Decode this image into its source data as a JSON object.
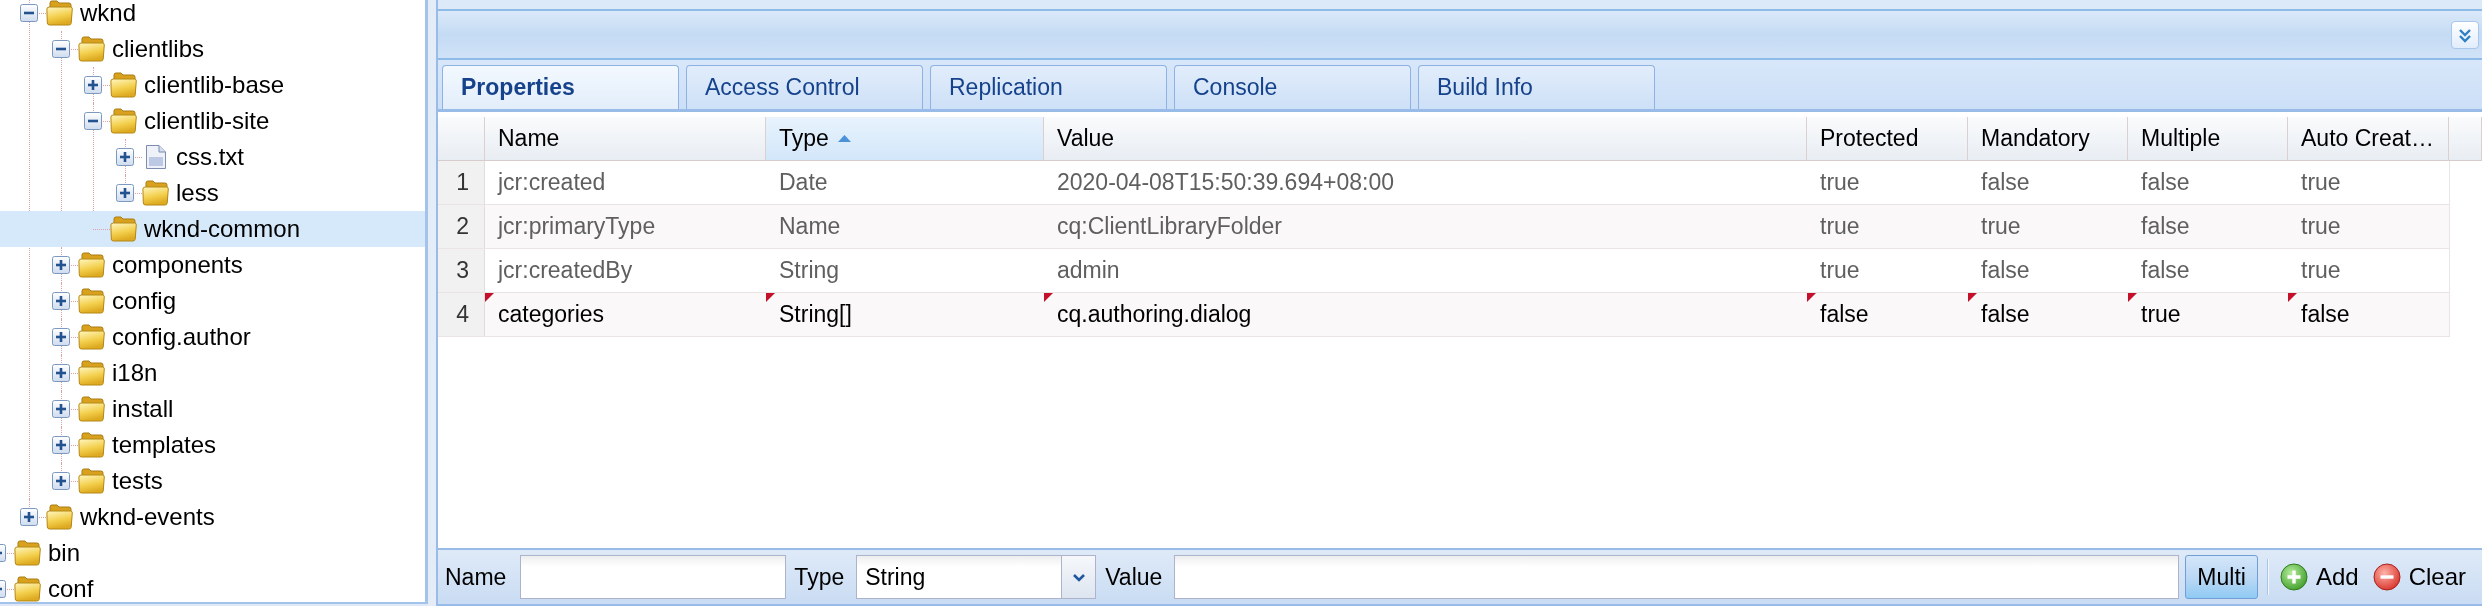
{
  "tree": {
    "items": [
      {
        "children": [
          {
            "label": "wknd",
            "kind": "folder",
            "leaf": false,
            "expanded": true,
            "selected": false,
            "children": [
              {
                "label": "clientlibs",
                "kind": "folder",
                "leaf": false,
                "expanded": true,
                "selected": false,
                "children": [
                  {
                    "label": "clientlib-base",
                    "kind": "folder",
                    "leaf": false,
                    "expanded": false,
                    "selected": false
                  },
                  {
                    "label": "clientlib-site",
                    "kind": "folder",
                    "leaf": false,
                    "expanded": true,
                    "selected": false,
                    "children": [
                      {
                        "label": "css.txt",
                        "kind": "file",
                        "leaf": false,
                        "expanded": false,
                        "selected": false
                      },
                      {
                        "label": "less",
                        "kind": "folder",
                        "leaf": false,
                        "expanded": false,
                        "selected": false
                      }
                    ]
                  },
                  {
                    "label": "wknd-common",
                    "kind": "folder",
                    "leaf": true,
                    "selected": true
                  }
                ]
              },
              {
                "label": "components",
                "kind": "folder",
                "leaf": false,
                "expanded": false,
                "selected": false
              },
              {
                "label": "config",
                "kind": "folder",
                "leaf": false,
                "expanded": false,
                "selected": false
              },
              {
                "label": "config.author",
                "kind": "folder",
                "leaf": false,
                "expanded": false,
                "selected": false
              },
              {
                "label": "i18n",
                "kind": "folder",
                "leaf": false,
                "expanded": false,
                "selected": false
              },
              {
                "label": "install",
                "kind": "folder",
                "leaf": false,
                "expanded": false,
                "selected": false
              },
              {
                "label": "templates",
                "kind": "folder",
                "leaf": false,
                "expanded": false,
                "selected": false
              },
              {
                "label": "tests",
                "kind": "folder",
                "leaf": false,
                "expanded": false,
                "selected": false
              }
            ]
          },
          {
            "label": "wknd-events",
            "kind": "folder",
            "leaf": false,
            "expanded": false,
            "selected": false
          }
        ]
      },
      {
        "label": "bin",
        "kind": "folder",
        "leaf": false,
        "selected": false
      },
      {
        "label": "conf",
        "kind": "folder",
        "leaf": false,
        "selected": false
      }
    ]
  },
  "panel": {
    "tabs": [
      {
        "label": "Properties",
        "selected": true
      },
      {
        "label": "Access Control",
        "selected": false
      },
      {
        "label": "Replication",
        "selected": false
      },
      {
        "label": "Console",
        "selected": false
      },
      {
        "label": "Build Info",
        "selected": false
      }
    ],
    "grid": {
      "columns": [
        {
          "label": "Name",
          "sorted": false
        },
        {
          "label": "Type",
          "sorted": true
        },
        {
          "label": "Value",
          "sorted": false
        },
        {
          "label": "Protected",
          "sorted": false
        },
        {
          "label": "Mandatory",
          "sorted": false
        },
        {
          "label": "Multiple",
          "sorted": false
        },
        {
          "label": "Auto Creat…",
          "sorted": false
        }
      ],
      "rows": [
        {
          "number": "1",
          "read_only": true,
          "modified": false,
          "cells": [
            "jcr:created",
            "Date",
            "2020-04-08T15:50:39.694+08:00",
            "true",
            "false",
            "false",
            "true"
          ]
        },
        {
          "number": "2",
          "read_only": true,
          "modified": false,
          "cells": [
            "jcr:primaryType",
            "Name",
            "cq:ClientLibraryFolder",
            "true",
            "true",
            "false",
            "true"
          ]
        },
        {
          "number": "3",
          "read_only": true,
          "modified": false,
          "cells": [
            "jcr:createdBy",
            "String",
            "admin",
            "true",
            "false",
            "false",
            "true"
          ]
        },
        {
          "number": "4",
          "read_only": false,
          "modified": true,
          "cells": [
            "categories",
            "String[]",
            "cq.authoring.dialog",
            "false",
            "false",
            "true",
            "false"
          ]
        }
      ]
    },
    "toolbar": {
      "name_field": {
        "label": "Name"
      },
      "type_field": {
        "label": "Type",
        "value": "String"
      },
      "value_field": {
        "label": "Value"
      },
      "multi_button": {
        "label": "Multi",
        "pressed": true
      },
      "actions": [
        {
          "label": "Add",
          "kind": "add"
        },
        {
          "label": "Clear",
          "kind": "clear"
        }
      ]
    }
  }
}
